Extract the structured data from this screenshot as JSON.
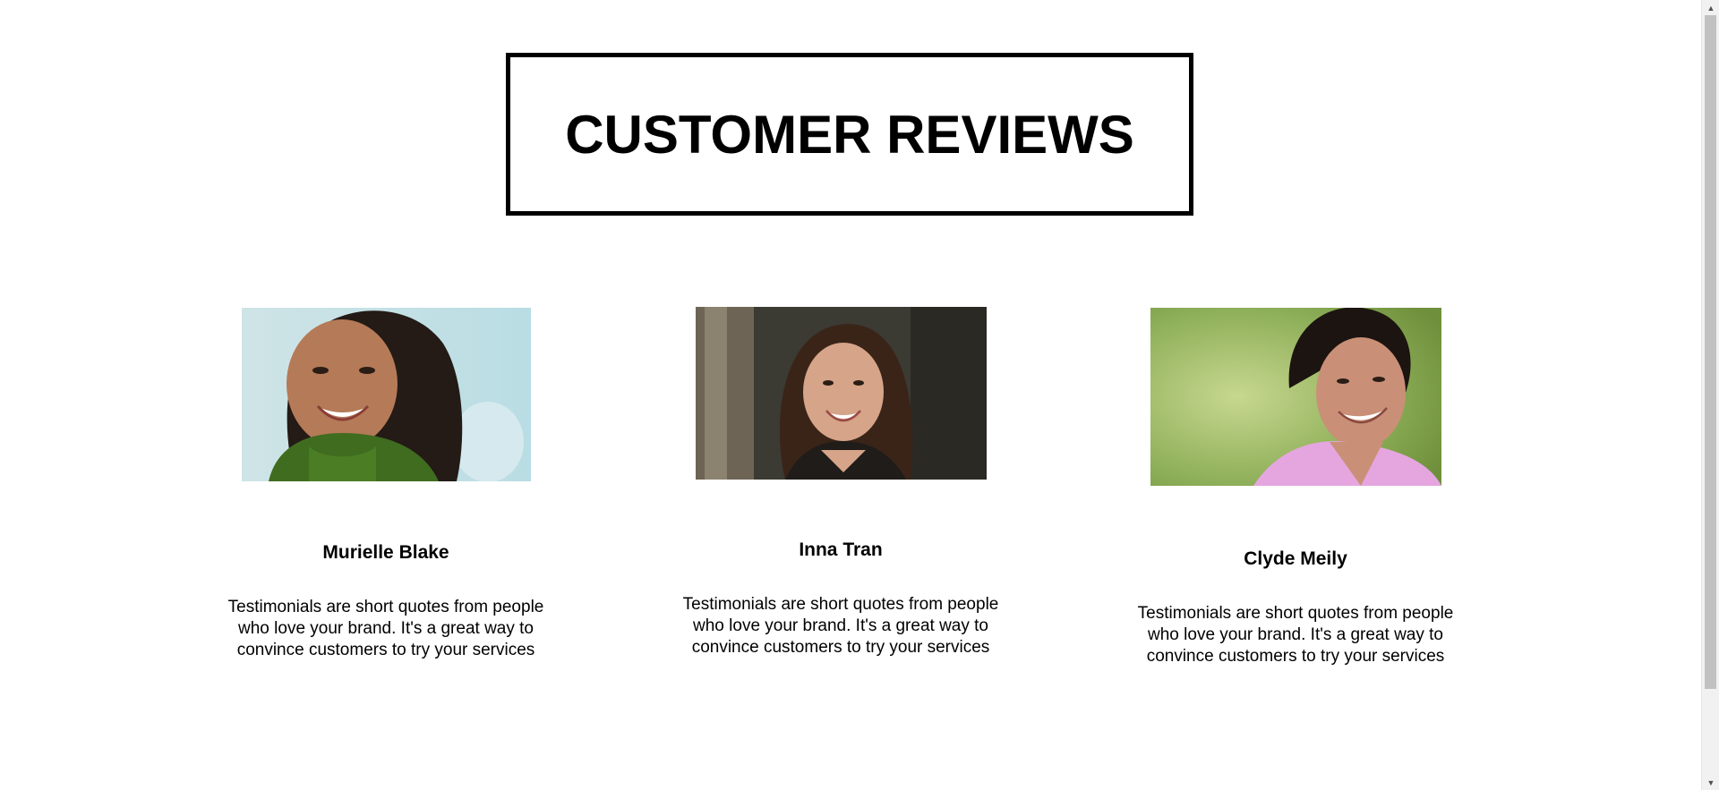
{
  "header": {
    "title": "CUSTOMER REVIEWS"
  },
  "reviews": [
    {
      "name": "Murielle Blake",
      "quote": "Testimonials are short quotes from people who love your brand. It's a great way to convince customers to try your services",
      "photo_description": "woman-portrait"
    },
    {
      "name": "Inna Tran",
      "quote": "Testimonials are short quotes from people who love your brand. It's a great way to convince customers to try your services",
      "photo_description": "woman-portrait"
    },
    {
      "name": "Clyde Meily",
      "quote": "Testimonials are short quotes from people who love your brand. It's a great way to convince customers to try your services",
      "photo_description": "man-portrait"
    }
  ],
  "colors": {
    "text": "#000000",
    "background": "#ffffff",
    "border": "#000000"
  }
}
